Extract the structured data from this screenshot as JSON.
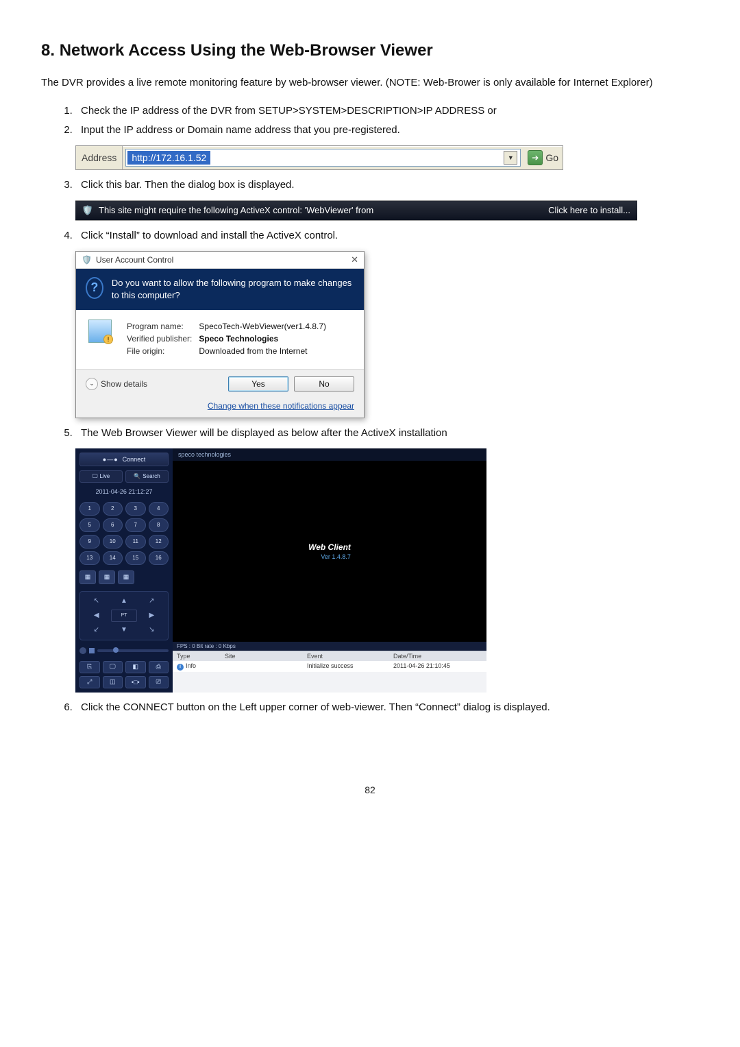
{
  "section": {
    "number": "8.",
    "title": "Network Access Using the Web-Browser Viewer"
  },
  "intro": "The DVR provides a live remote monitoring feature by web-browser viewer. (NOTE: Web-Brower is only available for Internet Explorer)",
  "steps": {
    "s1": "Check the IP address of the DVR from SETUP>SYSTEM>DESCRIPTION>IP ADDRESS or",
    "s2": "Input the IP address or Domain name address that you pre-registered.",
    "s3": "Click this bar. Then the dialog box is displayed.",
    "s4": "Click “Install” to download and install the ActiveX control.",
    "s5": "The Web Browser Viewer will be displayed as below after the ActiveX installation",
    "s6": "Click the CONNECT button on the Left upper corner of web-viewer. Then “Connect” dialog is displayed."
  },
  "address_bar": {
    "label": "Address",
    "url": "http://172.16.1.52",
    "go": "Go"
  },
  "activex_bar": {
    "text": "This site might require the following ActiveX control: 'WebViewer' from",
    "action": "Click here to install..."
  },
  "uac": {
    "title": "User Account Control",
    "question": "Do you want to allow the following program to make changes to this computer?",
    "labels": {
      "program_name": "Program name:",
      "publisher": "Verified publisher:",
      "origin": "File origin:"
    },
    "values": {
      "program_name": "SpecoTech-WebViewer(ver1.4.8.7)",
      "publisher": "Speco Technologies",
      "origin": "Downloaded from the Internet"
    },
    "show_details": "Show details",
    "yes": "Yes",
    "no": "No",
    "change_link": "Change when these notifications appear"
  },
  "viewer": {
    "connect": "Connect",
    "tab_live": "Live",
    "tab_search": "Search",
    "datetime": "2011-04-26 21:12:27",
    "channels": [
      "1",
      "2",
      "3",
      "4",
      "5",
      "6",
      "7",
      "8",
      "9",
      "10",
      "11",
      "12",
      "13",
      "14",
      "15",
      "16"
    ],
    "ptz_center": "PT",
    "brand": "speco technologies",
    "web_client": "Web  Client",
    "version": "Ver 1.4.8.7",
    "status": "FPS : 0   Bit rate : 0 Kbps",
    "table": {
      "headers": {
        "type": "Type",
        "site": "Site",
        "event": "Event",
        "datetime": "Date/Time"
      },
      "row": {
        "type": "Info",
        "site": "",
        "event": "Initialize success",
        "datetime": "2011-04-26 21:10:45"
      }
    }
  },
  "page_number": "82"
}
